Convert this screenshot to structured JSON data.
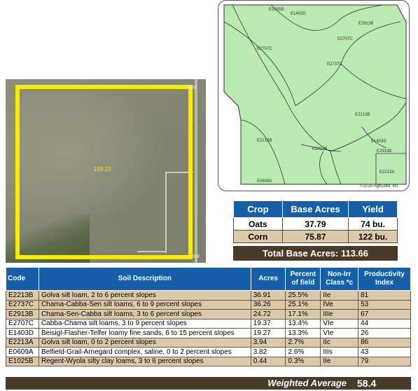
{
  "aerial": {
    "acre_label": "159.23",
    "corner_label_top": "NW",
    "corner_label_bottom": "SW"
  },
  "soil_map": {
    "labels": [
      "E1025B",
      "E1403D",
      "E2913B",
      "E2707C",
      "E2707C",
      "E2737C",
      "E2213B",
      "E2213B",
      "E2913B",
      "E1403D",
      "E2913B",
      "E2213A",
      "E0609A"
    ],
    "copyright": "©2025 AgriData, Inc."
  },
  "crop_table": {
    "headers": [
      "Crop",
      "Base Acres",
      "Yield"
    ],
    "rows": [
      {
        "crop": "Oats",
        "base_acres": "37.79",
        "yield": "74 bu."
      },
      {
        "crop": "Corn",
        "base_acres": "75.87",
        "yield": "122 bu."
      }
    ],
    "total": "Total Base Acres: 113.66"
  },
  "soil_table": {
    "headers": {
      "code": "Code",
      "description": "Soil Description",
      "acres": "Acres",
      "percent": "Percent of field",
      "class": "Non-Irr Class *c",
      "index": "Productivity Index"
    },
    "rows": [
      {
        "code": "E2213B",
        "description": "Golva silt loam, 2 to 6 percent slopes",
        "acres": "36.91",
        "percent": "25.5%",
        "class": "IIe",
        "index": "81"
      },
      {
        "code": "E2737C",
        "description": "Chama-Cabba-Sen silt loams, 6 to 9 percent slopes",
        "acres": "36.26",
        "percent": "25.1%",
        "class": "IVe",
        "index": "53"
      },
      {
        "code": "E2913B",
        "description": "Chama-Sen-Cabba silt loams, 3 to 6 percent slopes",
        "acres": "24.72",
        "percent": "17.1%",
        "class": "IIIe",
        "index": "67"
      },
      {
        "code": "E2707C",
        "description": "Cabba-Chama silt loams, 3 to 9 percent slopes",
        "acres": "19.37",
        "percent": "13.4%",
        "class": "VIe",
        "index": "44"
      },
      {
        "code": "E1403D",
        "description": "Beisigl-Flasher-Telfer loamy fine sands, 6 to 15 percent slopes",
        "acres": "19.27",
        "percent": "13.3%",
        "class": "VIe",
        "index": "26"
      },
      {
        "code": "E2213A",
        "description": "Golva silt loam, 0 to 2 percent slopes",
        "acres": "3.94",
        "percent": "2.7%",
        "class": "IIc",
        "index": "86"
      },
      {
        "code": "E0609A",
        "description": "Belfield-Grail-Arnegard complex, saline, 0 to 2 percent slopes",
        "acres": "3.82",
        "percent": "2.6%",
        "class": "IIIs",
        "index": "43"
      },
      {
        "code": "E1025B",
        "description": "Regent-Wyola silty clay loams, 3 to 6 percent slopes",
        "acres": "0.44",
        "percent": "0.3%",
        "class": "IIe",
        "index": "79"
      }
    ],
    "weighted_average_label": "Weighted Average",
    "weighted_average_value": "58.4"
  },
  "colors": {
    "header_blue": "#1560a8",
    "row_tan": "#dcc9a9",
    "total_brown": "#4a3a2a",
    "map_green": "#b9eab0",
    "boundary_yellow": "#f5ec00"
  }
}
